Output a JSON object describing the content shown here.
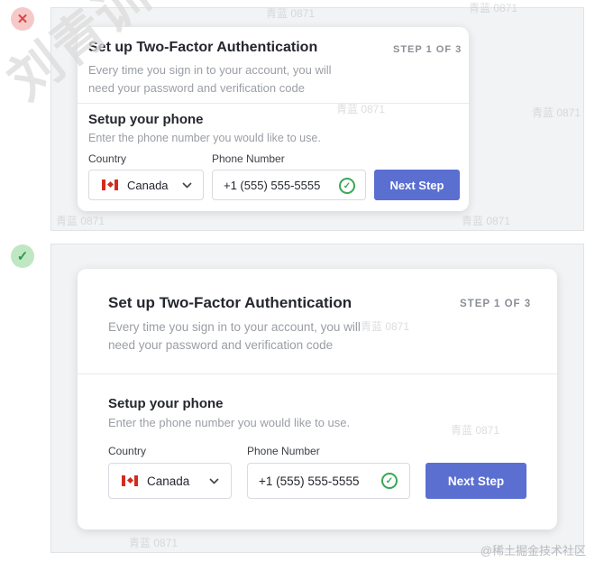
{
  "examples": {
    "bad_badge": "✕",
    "good_badge": "✓"
  },
  "card_top": {
    "title": "Set up Two-Factor Authentication",
    "step": "STEP 1 OF 3",
    "desc_line1": "Every time you sign in to your account, you will",
    "desc_line2": "need your password and verification code",
    "subtitle": "Setup your phone",
    "subdesc": "Enter the phone number you would like to use.",
    "country_label": "Country",
    "country_value": "Canada",
    "phone_label": "Phone Number",
    "phone_value": "+1 (555) 555-5555",
    "button": "Next Step"
  },
  "card_bottom": {
    "title": "Set up Two-Factor Authentication",
    "step": "STEP 1 OF 3",
    "desc_line1": "Every time you sign in to your account, you will",
    "desc_line2": "need your password and verification code",
    "subtitle": "Setup your phone",
    "subdesc": "Enter the phone number you would like to use.",
    "country_label": "Country",
    "country_value": "Canada",
    "phone_label": "Phone Number",
    "phone_value": "+1 (555) 555-5555",
    "button": "Next Step"
  },
  "watermark": {
    "big": "刘青训",
    "small": "青蓝 0871",
    "credit": "@稀土掘金技术社区"
  },
  "colors": {
    "accent": "#5b6fd1",
    "success": "#3aa655",
    "error_badge": "#f6c9c9",
    "success_badge": "#bfe7c4",
    "flag_red": "#d52b1e"
  }
}
